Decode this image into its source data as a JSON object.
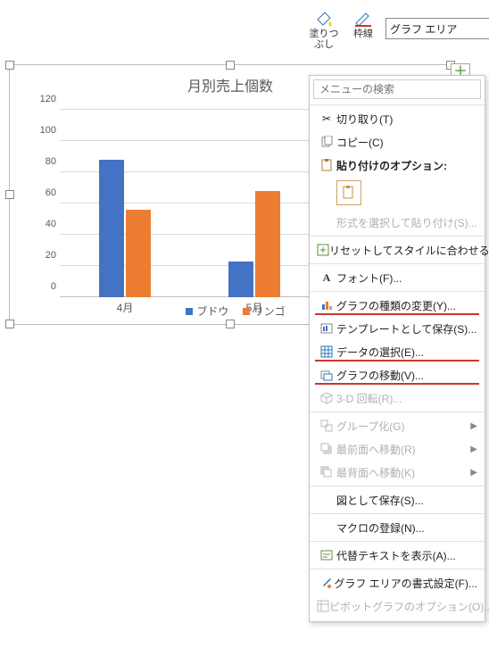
{
  "chart_data": {
    "type": "bar",
    "title": "月別売上個数",
    "xlabel": "",
    "ylabel": "",
    "ylim": [
      0,
      120
    ],
    "yticks": [
      0,
      20,
      40,
      60,
      80,
      100,
      120
    ],
    "categories": [
      "4月",
      "5月"
    ],
    "series": [
      {
        "name": "ブドウ",
        "color": "#4472C4",
        "values": [
          88,
          23
        ]
      },
      {
        "name": "リンゴ",
        "color": "#ED7D31",
        "values": [
          56,
          68
        ]
      }
    ]
  },
  "toolbar": {
    "fill_label": "塗りつぶし",
    "outline_label": "枠線",
    "selector_value": "グラフ エリア"
  },
  "menu": {
    "search_placeholder": "メニューの検索",
    "cut": "切り取り(T)",
    "copy": "コピー(C)",
    "paste_options_title": "貼り付けのオプション:",
    "paste_special": "形式を選択して貼り付け(S)...",
    "reset_style": "リセットしてスタイルに合わせる(A)",
    "font": "フォント(F)...",
    "change_type": "グラフの種類の変更(Y)...",
    "save_template": "テンプレートとして保存(S)...",
    "select_data": "データの選択(E)...",
    "move_chart": "グラフの移動(V)...",
    "rotate3d": "3-D 回転(R)...",
    "group": "グループ化(G)",
    "bring_front": "最前面へ移動(R)",
    "send_back": "最背面へ移動(K)",
    "save_as_picture": "図として保存(S)...",
    "assign_macro": "マクロの登録(N)...",
    "alt_text": "代替テキストを表示(A)...",
    "format_area": "グラフ エリアの書式設定(F)...",
    "pivot_options": "ピボットグラフのオプション(O)..."
  },
  "legend": {
    "s1": "ブドウ",
    "s2": "リンゴ"
  },
  "axis": {
    "x1": "4月",
    "x2": "5月",
    "y0": "0",
    "y20": "20",
    "y40": "40",
    "y60": "60",
    "y80": "80",
    "y100": "100",
    "y120": "120"
  }
}
